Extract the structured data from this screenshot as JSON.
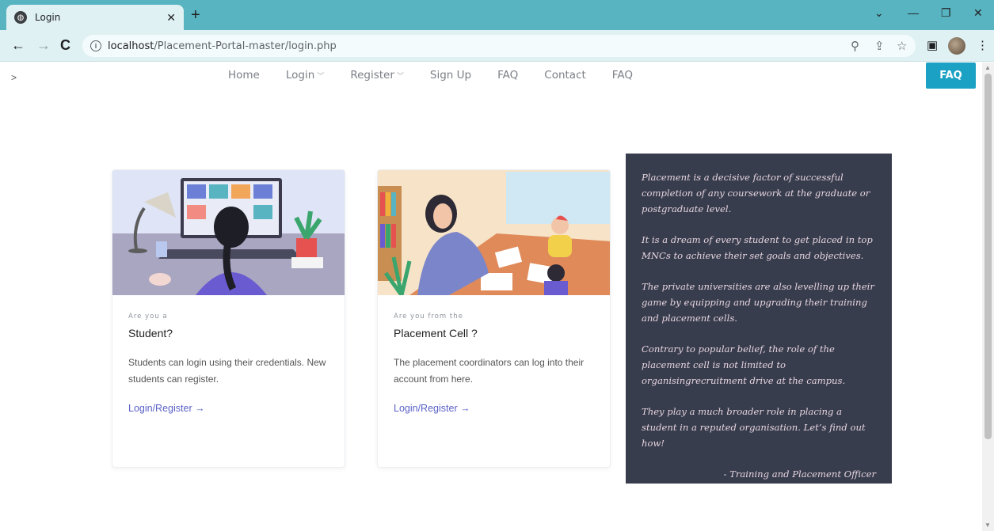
{
  "browser": {
    "tab_title": "Login",
    "url_host": "localhost",
    "url_path": "/Placement-Portal-master/login.php"
  },
  "nav": {
    "left_mark": ">",
    "items": [
      "Home",
      "Login",
      "Register",
      "Sign Up",
      "FAQ",
      "Contact",
      "FAQ"
    ],
    "faq_button": "FAQ"
  },
  "cards": [
    {
      "eyebrow": "Are you a",
      "title": "Student?",
      "text": "Students can login using their credentials. New students can register.",
      "link": "Login/Register"
    },
    {
      "eyebrow": "Are you from the",
      "title": "Placement Cell ?",
      "text": "The placement coordinators can log into their account from here.",
      "link": "Login/Register"
    }
  ],
  "quote": {
    "paragraphs": [
      "Placement is a decisive factor of successful completion of any coursework at the graduate or postgraduate level.",
      "It is a dream of every student to get placed in top MNCs to achieve their set goals and objectives.",
      "The private universities are also levelling up their game by equipping and upgrading their training and placement cells.",
      "Contrary to popular belief, the role of the placement cell is not limited to organisingrecruitment drive at the campus.",
      "They play a much broader role in placing a student in a reputed organisation. Let’s find out how!"
    ],
    "signature": "- Training and Placement Officer"
  },
  "colors": {
    "tabbar": "#58b4c0",
    "accent": "#1ba1c4",
    "quote_bg": "#383d4d",
    "link": "#5b62c8"
  }
}
